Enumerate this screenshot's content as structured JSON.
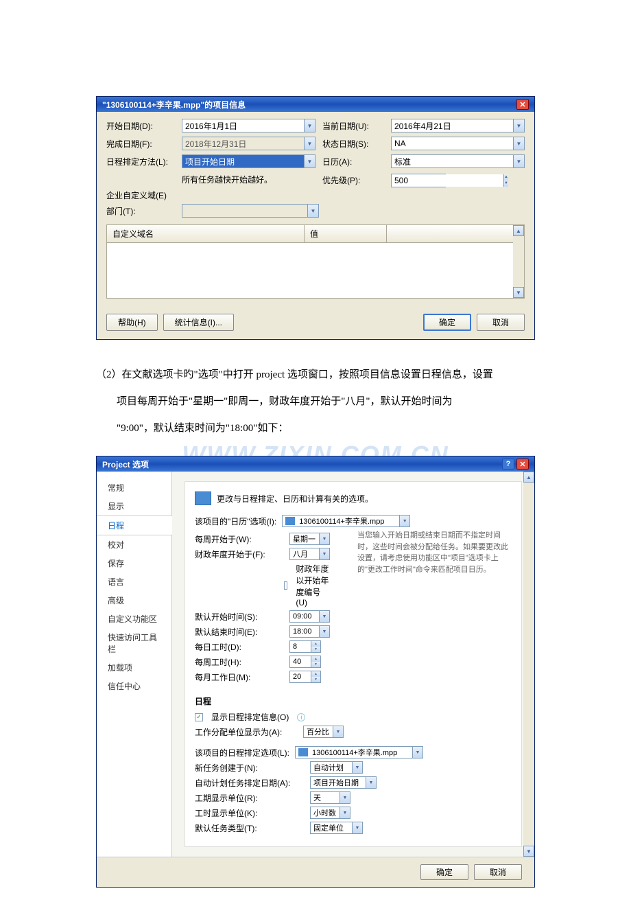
{
  "dialog1": {
    "title": "\"1306100114+李辛果.mpp\"的项目信息",
    "labels": {
      "startDate": "开始日期(D):",
      "endDate": "完成日期(F):",
      "scheduleFrom": "日程排定方法(L):",
      "enterpriseField": "企业自定义域(E)",
      "department": "部门(T):",
      "currentDate": "当前日期(U):",
      "statusDate": "状态日期(S):",
      "calendar": "日历(A):",
      "priority": "优先级(P):",
      "note": "所有任务越快开始越好。"
    },
    "values": {
      "startDate": "2016年1月1日",
      "endDate": "2018年12月31日",
      "scheduleFrom": "项目开始日期",
      "currentDate": "2016年4月21日",
      "statusDate": "NA",
      "calendar": "标准",
      "priority": "500"
    },
    "table": {
      "col1": "自定义域名",
      "col2": "值"
    },
    "buttons": {
      "help": "帮助(H)",
      "stats": "统计信息(I)...",
      "ok": "确定",
      "cancel": "取消"
    }
  },
  "desc": {
    "line1": "（2）在文献选项卡旳\"选项\"中打开 project 选项窗口，按照项目信息设置日程信息，设置",
    "line2": "项目每周开始于\"星期一\"即周一，财政年度开始于\"八月\"，默认开始时间为",
    "line3": "\"9:00\"，默认结束时间为\"18:00\"如下："
  },
  "watermark": "WWW.ZIXIN.COM.CN",
  "dialog2": {
    "title": "Project 选项",
    "sidebar": [
      "常规",
      "显示",
      "日程",
      "校对",
      "保存",
      "语言",
      "高级",
      "自定义功能区",
      "快速访问工具栏",
      "加载项",
      "信任中心"
    ],
    "activeIdx": 2,
    "headerText": "更改与日程排定、日历和计算有关的选项。",
    "calOptionsLabel": "该项目的\"日历\"选项(I):",
    "projFile": "1306100114+李辛果.mpp",
    "rows": {
      "weekStart": {
        "label": "每周开始于(W):",
        "value": "星期一"
      },
      "fiscalStart": {
        "label": "财政年度开始于(F):",
        "value": "八月"
      },
      "fiscalCheckbox": "财政年度以开始年度编号(U)",
      "defaultStart": {
        "label": "默认开始时间(S):",
        "value": "09:00"
      },
      "defaultEnd": {
        "label": "默认结束时间(E):",
        "value": "18:00"
      },
      "hoursPerDay": {
        "label": "每日工时(D):",
        "value": "8"
      },
      "hoursPerWeek": {
        "label": "每周工时(H):",
        "value": "40"
      },
      "daysPerMonth": {
        "label": "每月工作日(M):",
        "value": "20"
      },
      "hint": "当您输入开始日期或结束日期而不指定时间时，这些时间会被分配给任务。如果要更改此设置，请考虑使用功能区中\"项目\"选项卡上的\"更改工作时间\"命令来匹配项目日历。"
    },
    "schedule": {
      "title": "日程",
      "showMsg": "显示日程排定信息(O)",
      "unitLabel": "工作分配单位显示为(A):",
      "unitValue": "百分比",
      "projSchedLabel": "该项目的日程排定选项(L):",
      "newTask": {
        "label": "新任务创建于(N):",
        "value": "自动计划"
      },
      "autoSchedDate": {
        "label": "自动计划任务排定日期(A):",
        "value": "项目开始日期"
      },
      "durationUnit": {
        "label": "工期显示单位(R):",
        "value": "天"
      },
      "workUnit": {
        "label": "工时显示单位(K):",
        "value": "小时数"
      },
      "defaultTaskType": {
        "label": "默认任务类型(T):",
        "value": "固定单位"
      }
    },
    "buttons": {
      "ok": "确定",
      "cancel": "取消"
    }
  }
}
